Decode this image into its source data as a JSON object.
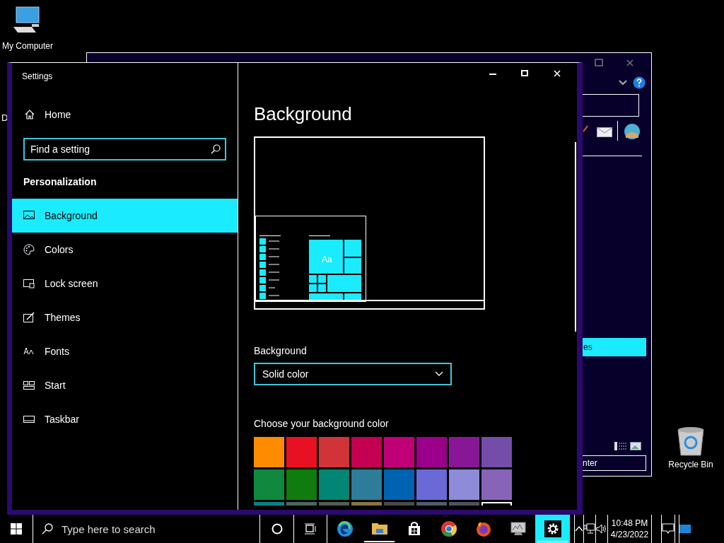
{
  "desktop_icons": [
    {
      "kind": "computer",
      "label": "My Computer"
    },
    {
      "kind": "recycle",
      "label": "Recycle Bin"
    }
  ],
  "desktop_partial_label": "D",
  "background_window": {
    "selected_item_text": "es",
    "field_text": "nter"
  },
  "settings": {
    "title": "Settings",
    "home": "Home",
    "search": {
      "placeholder": "Find a setting"
    },
    "section": "Personalization",
    "nav": [
      {
        "kind": "background",
        "label": "Background",
        "selected": true
      },
      {
        "kind": "colors",
        "label": "Colors",
        "selected": false
      },
      {
        "kind": "lock",
        "label": "Lock screen",
        "selected": false
      },
      {
        "kind": "themes",
        "label": "Themes",
        "selected": false
      },
      {
        "kind": "fonts",
        "label": "Fonts",
        "selected": false
      },
      {
        "kind": "start",
        "label": "Start",
        "selected": false
      },
      {
        "kind": "taskbar",
        "label": "Taskbar",
        "selected": false
      }
    ],
    "heading": "Background",
    "preview_tile_text": "Aa",
    "background_label": "Background",
    "dropdown": {
      "value": "Solid color"
    },
    "color_label": "Choose your background color",
    "swatches": [
      {
        "color": "#ff8c00",
        "selected": false
      },
      {
        "color": "#e81123",
        "selected": false
      },
      {
        "color": "#d13438",
        "selected": false
      },
      {
        "color": "#c30052",
        "selected": false
      },
      {
        "color": "#bf0077",
        "selected": false
      },
      {
        "color": "#9a0089",
        "selected": false
      },
      {
        "color": "#881798",
        "selected": false
      },
      {
        "color": "#744da9",
        "selected": false
      },
      {
        "color": "#10893e",
        "selected": false
      },
      {
        "color": "#107c10",
        "selected": false
      },
      {
        "color": "#018574",
        "selected": false
      },
      {
        "color": "#2d7d9a",
        "selected": false
      },
      {
        "color": "#0063b1",
        "selected": false
      },
      {
        "color": "#6b69d6",
        "selected": false
      },
      {
        "color": "#8e8cd8",
        "selected": false
      },
      {
        "color": "#8764b8",
        "selected": false
      },
      {
        "color": "#038387",
        "selected": false
      },
      {
        "color": "#486860",
        "selected": false
      },
      {
        "color": "#525e54",
        "selected": false
      },
      {
        "color": "#847545",
        "selected": false
      },
      {
        "color": "#4c4a48",
        "selected": false
      },
      {
        "color": "#515c6b",
        "selected": false
      },
      {
        "color": "#4a5459",
        "selected": false
      },
      {
        "color": "#000000",
        "selected": true
      }
    ]
  },
  "taskbar": {
    "search": {
      "placeholder": "Type here to search"
    },
    "apps": [
      {
        "kind": "edge",
        "open": false,
        "selected": false
      },
      {
        "kind": "explorer",
        "open": true,
        "selected": false
      },
      {
        "kind": "store",
        "open": false,
        "selected": false
      },
      {
        "kind": "chrome",
        "open": false,
        "selected": false
      },
      {
        "kind": "firefox",
        "open": false,
        "selected": false
      },
      {
        "kind": "monitor",
        "open": false,
        "selected": false
      },
      {
        "kind": "settings",
        "open": true,
        "selected": true
      }
    ],
    "time": "10:48 PM",
    "date": "4/23/2022"
  }
}
